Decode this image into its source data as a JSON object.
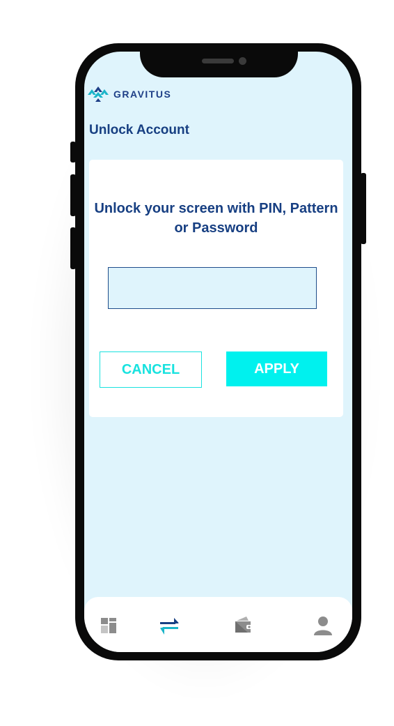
{
  "app": {
    "brand": "GRAVITUS",
    "page_title": "Unlock Account"
  },
  "card": {
    "message": "Unlock your screen with PIN, Pattern or Password",
    "input_value": "",
    "cancel_label": "CANCEL",
    "apply_label": "APPLY"
  },
  "tabbar": {
    "items": [
      {
        "icon": "dashboard-icon",
        "active": false
      },
      {
        "icon": "transfer-icon",
        "active": true
      },
      {
        "icon": "wallet-icon",
        "active": false
      },
      {
        "icon": "profile-icon",
        "active": false
      }
    ]
  },
  "colors": {
    "screen_bg": "#dff4fc",
    "brand_navy": "#173f82",
    "accent_cyan": "#00f1ee",
    "icon_gray": "#8c8c8c"
  }
}
